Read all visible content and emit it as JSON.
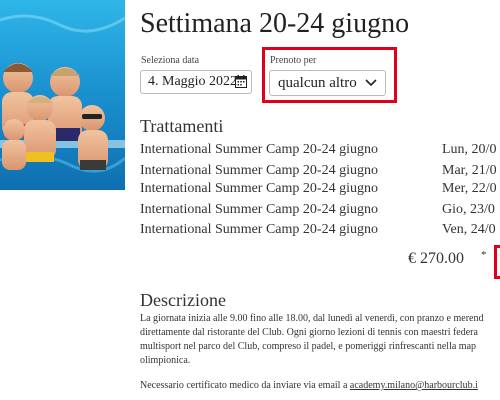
{
  "page": {
    "title": "Settimana 20-24 giugno"
  },
  "booking": {
    "date_label": "Seleziona data",
    "date_value": "4. Maggio 2022",
    "booked_for_label": "Prenoto per",
    "booked_for_value": "qualcun altro"
  },
  "treatments": {
    "heading": "Trattamenti",
    "items": [
      {
        "name": "International Summer Camp 20-24 giugno",
        "date": "Lun, 20/0"
      },
      {
        "name": "International Summer Camp 20-24 giugno",
        "date": "Mar, 21/0"
      },
      {
        "name": "International Summer Camp 20-24 giugno",
        "date": "Mer, 22/0"
      },
      {
        "name": "International Summer Camp 20-24 giugno",
        "date": "Gio, 23/0"
      },
      {
        "name": "International Summer Camp 20-24 giugno",
        "date": "Ven, 24/0"
      }
    ]
  },
  "price": {
    "amount": "€ 270.00",
    "asterisk": "*"
  },
  "description": {
    "heading": "Descrizione",
    "lines": [
      "La giornata inizia alle 9.00 fino alle 18.00, dal lunedì al venerdì, con pranzo e merend",
      "direttamente dal ristorante del Club. Ogni giorno lezioni di tennis con maestri federa",
      "multisport nel parco del Club, compreso il padel, e pomeriggi rinfrescanti nella map",
      "olimpionica."
    ],
    "note_prefix": "Necessario certificato medico da inviare via email a ",
    "note_email": "academy.milano@harbourclub.i"
  },
  "icons": {
    "calendar": "calendar-icon",
    "chevron": "chevron-down-icon"
  },
  "colors": {
    "highlight": "#e0001b"
  }
}
